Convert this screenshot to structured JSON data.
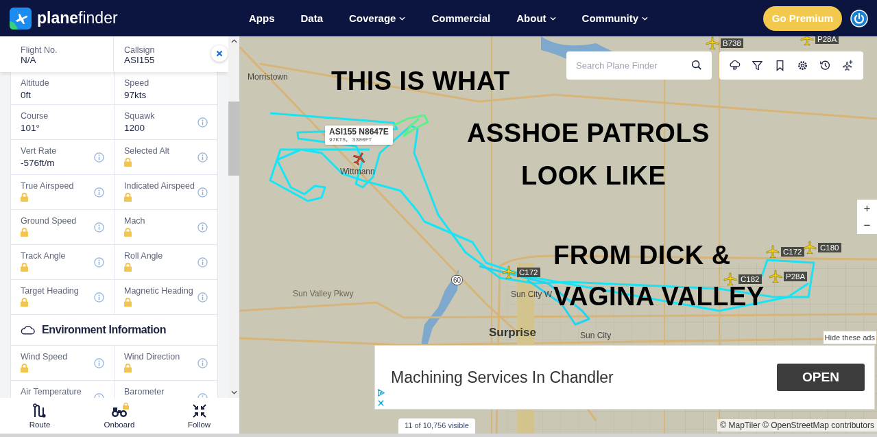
{
  "header": {
    "logo_text": "**plane**finder",
    "nav": [
      {
        "label": "Apps",
        "dropdown": false
      },
      {
        "label": "Data",
        "dropdown": false
      },
      {
        "label": "Coverage",
        "dropdown": true
      },
      {
        "label": "Commercial",
        "dropdown": false
      },
      {
        "label": "About",
        "dropdown": true
      },
      {
        "label": "Community",
        "dropdown": true
      }
    ],
    "premium_button": "Go Premium"
  },
  "flight_panel": {
    "top_fields": [
      {
        "label": "Flight No.",
        "value": "N/A"
      },
      {
        "label": "Callsign",
        "value": "ASI155"
      }
    ],
    "fields": [
      {
        "label": "Altitude",
        "value": "0ft",
        "locked": false,
        "info": false
      },
      {
        "label": "Speed",
        "value": "97kts",
        "locked": false,
        "info": false
      },
      {
        "label": "Course",
        "value": "101°",
        "locked": false,
        "info": false
      },
      {
        "label": "Squawk",
        "value": "1200",
        "locked": false,
        "info": true
      },
      {
        "label": "Vert Rate",
        "value": "-576ft/m",
        "locked": false,
        "info": true
      },
      {
        "label": "Selected Alt",
        "locked": true,
        "info": true
      },
      {
        "label": "True Airspeed",
        "locked": true,
        "info": true
      },
      {
        "label": "Indicated Airspeed",
        "locked": true,
        "info": true
      },
      {
        "label": "Ground Speed",
        "locked": true,
        "info": true
      },
      {
        "label": "Mach",
        "locked": true,
        "info": true
      },
      {
        "label": "Track Angle",
        "locked": true,
        "info": true
      },
      {
        "label": "Roll Angle",
        "locked": true,
        "info": true
      },
      {
        "label": "Target Heading",
        "locked": true,
        "info": true
      },
      {
        "label": "Magnetic Heading",
        "locked": true,
        "info": true
      }
    ],
    "environment_title": "Environment Information",
    "environment_fields": [
      {
        "label": "Wind Speed",
        "locked": true,
        "info": true
      },
      {
        "label": "Wind Direction",
        "locked": true,
        "info": true
      },
      {
        "label": "Air Temperature",
        "info": true
      },
      {
        "label": "Barometer",
        "info": true
      }
    ],
    "actions": [
      {
        "kind": "route",
        "label": "Route",
        "locked": false
      },
      {
        "kind": "onboard",
        "label": "Onboard",
        "locked": true
      },
      {
        "kind": "follow",
        "label": "Follow",
        "locked": false
      }
    ]
  },
  "map": {
    "search": {
      "placeholder": "Search Plane Finder"
    },
    "places": [
      {
        "kind": "town",
        "label": "Morristown"
      },
      {
        "kind": "town",
        "label": "Wittmann"
      },
      {
        "kind": "road",
        "label": "Sun Valley Pkwy"
      },
      {
        "kind": "town",
        "label": "Sun City W"
      },
      {
        "kind": "city",
        "label": "Surprise"
      },
      {
        "kind": "town",
        "label": "Sun City"
      },
      {
        "kind": "shield",
        "label": "60"
      }
    ],
    "aircraft": [
      {
        "type": "B738"
      },
      {
        "type": "P28A"
      },
      {
        "type": "C172"
      },
      {
        "type": "C172"
      },
      {
        "type": "C180"
      },
      {
        "type": "C182"
      },
      {
        "type": "P28A"
      }
    ],
    "selected_aircraft": {
      "title": "ASI155 N8647E",
      "detail": "97KTS, 3300FT"
    },
    "overlay_text": [
      "THIS IS WHAT",
      "ASSHOE PATROLS",
      "LOOK LIKE",
      "FROM DICK &",
      "VAGINA VALLEY"
    ],
    "zoom_buttons": [
      "+",
      "−"
    ],
    "ad": {
      "hide_link": "Hide these ads",
      "headline": "Machining Services In Chandler",
      "button": "OPEN"
    },
    "visible_count": "11 of 10,756 visible",
    "attribution": "© MapTiler © OpenStreetMap contributors"
  }
}
